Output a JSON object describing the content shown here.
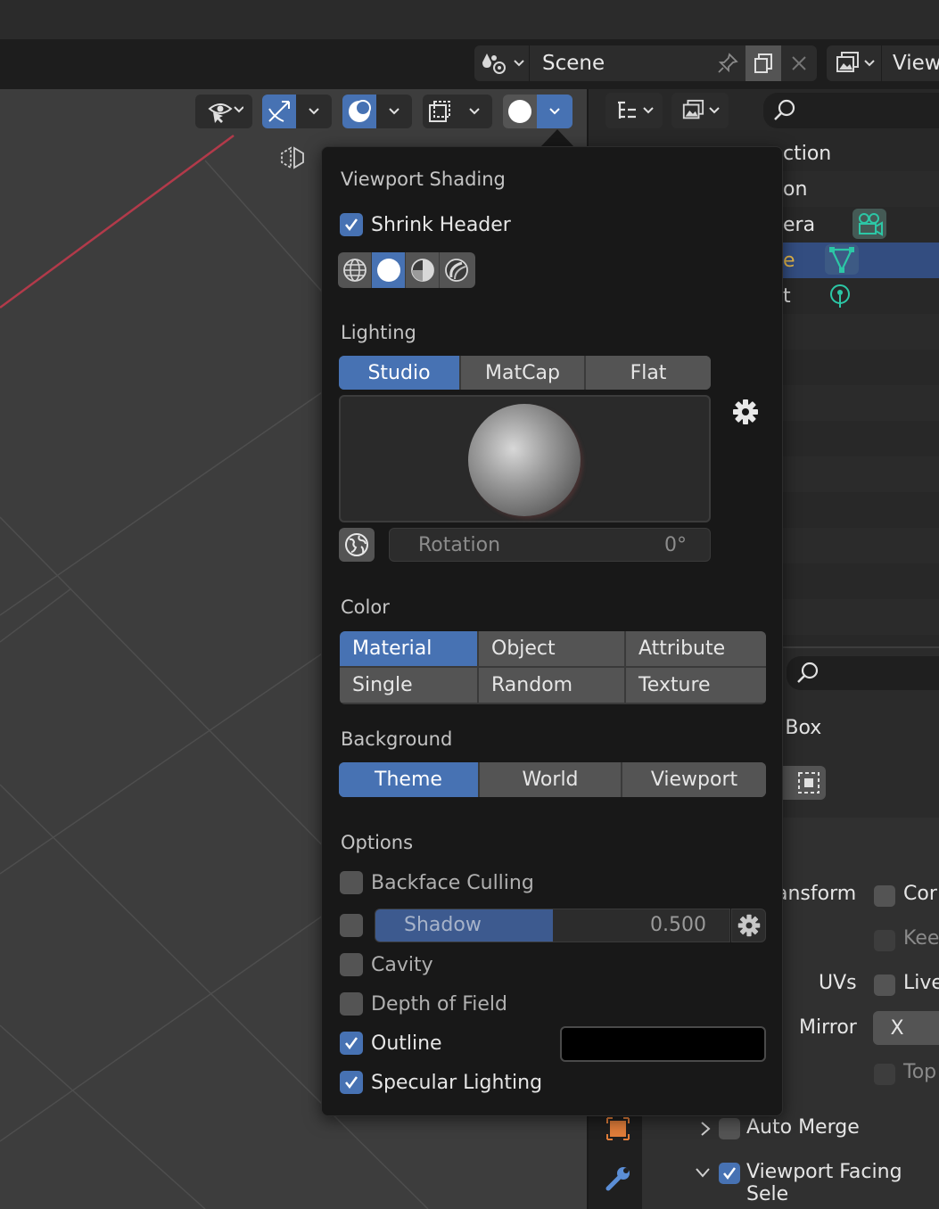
{
  "scene_selector": {
    "name": "Scene"
  },
  "view_layer_selector": {
    "name": "View"
  },
  "outliner": {
    "rows": [
      {
        "label": "ction"
      },
      {
        "label": "on"
      },
      {
        "label": "era"
      },
      {
        "label": "e"
      },
      {
        "label": "t"
      }
    ]
  },
  "properties": {
    "object_label": ": Box",
    "labels": {
      "transform": "ansform",
      "uvs": "UVs",
      "mirror": "Mirror",
      "correct": "Cor",
      "keep": "Kee",
      "live": "Live",
      "topology": "Top",
      "mirror_x": "X",
      "auto_merge": "Auto Merge",
      "viewport_facing": "Viewport Facing Sele"
    }
  },
  "popover": {
    "title": "Viewport Shading",
    "shrink_header": {
      "label": "Shrink Header",
      "checked": true
    },
    "shading_modes": [
      "wireframe",
      "solid",
      "material-preview",
      "rendered"
    ],
    "shading_active": "solid",
    "lighting": {
      "title": "Lighting",
      "options": [
        "Studio",
        "MatCap",
        "Flat"
      ],
      "active": "Studio",
      "rotation_label": "Rotation",
      "rotation_value": "0°"
    },
    "color": {
      "title": "Color",
      "options": [
        "Material",
        "Object",
        "Attribute",
        "Single",
        "Random",
        "Texture"
      ],
      "active": "Material"
    },
    "background": {
      "title": "Background",
      "options": [
        "Theme",
        "World",
        "Viewport"
      ],
      "active": "Theme"
    },
    "options": {
      "title": "Options",
      "backface_culling": {
        "label": "Backface Culling",
        "checked": false
      },
      "shadow": {
        "label": "Shadow",
        "value": "0.500",
        "fraction": 0.5,
        "checked": false
      },
      "cavity": {
        "label": "Cavity",
        "checked": false
      },
      "depth_of_field": {
        "label": "Depth of Field",
        "checked": false
      },
      "outline": {
        "label": "Outline",
        "checked": true,
        "color": "#000000"
      },
      "specular_lighting": {
        "label": "Specular Lighting",
        "checked": true
      }
    }
  },
  "colors": {
    "accent": "#4772b3",
    "panel": "#181818",
    "x_axis": "#b23a4a",
    "object_teal": "#2cc7a6"
  }
}
